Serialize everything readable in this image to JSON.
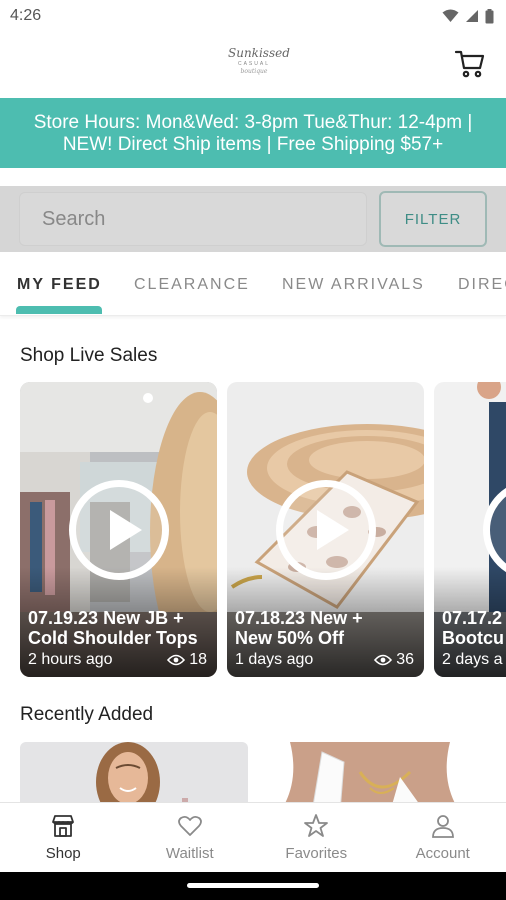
{
  "status_bar": {
    "time": "4:26"
  },
  "header": {
    "logo_main": "Sunkissed",
    "logo_sub": "CASUAL",
    "logo_tag": "boutique"
  },
  "banner": {
    "line1": "Store Hours: Mon&Wed: 3-8pm Tue&Thur: 12-4pm |",
    "line2": "NEW! Direct Ship items | Free Shipping $57+",
    "color": "#4dbdb0"
  },
  "search": {
    "placeholder": "Search",
    "filter_label": "FILTER"
  },
  "tabs": [
    {
      "label": "MY FEED",
      "active": true
    },
    {
      "label": "CLEARANCE",
      "active": false
    },
    {
      "label": "NEW ARRIVALS",
      "active": false
    },
    {
      "label": "DIREC",
      "active": false
    }
  ],
  "live_sales": {
    "title": "Shop Live Sales",
    "cards": [
      {
        "line1": "07.19.23 New JB +",
        "line2": "Cold Shoulder Tops",
        "time": "2 hours ago",
        "views": "18"
      },
      {
        "line1": "07.18.23 New +",
        "line2": "New 50% Off",
        "time": "1 days ago",
        "views": "36"
      },
      {
        "line1": "07.17.2",
        "line2": "Bootcu",
        "time": "2 days a",
        "views": ""
      }
    ]
  },
  "recently_added": {
    "title": "Recently Added"
  },
  "bottom_nav": [
    {
      "label": "Shop",
      "icon": "shop-icon",
      "active": true
    },
    {
      "label": "Waitlist",
      "icon": "heart-icon",
      "active": false
    },
    {
      "label": "Favorites",
      "icon": "star-icon",
      "active": false
    },
    {
      "label": "Account",
      "icon": "person-icon",
      "active": false
    }
  ]
}
